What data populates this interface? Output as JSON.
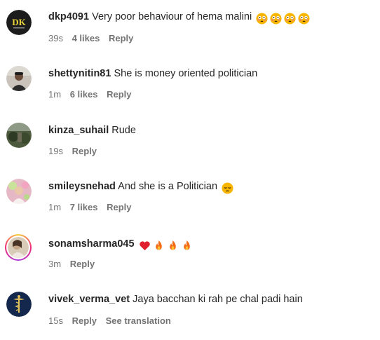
{
  "comments": [
    {
      "username": "dkp4091",
      "text": "Very poor behaviour of hema malini",
      "emoji": [
        "flushed-face",
        "flushed-face",
        "flushed-face",
        "flushed-face"
      ],
      "time": "39s",
      "likes": "4 likes",
      "reply": "Reply",
      "avatar_text": "DK"
    },
    {
      "username": "shettynitin81",
      "text": "She is money oriented politician",
      "emoji": [],
      "time": "1m",
      "likes": "6 likes",
      "reply": "Reply"
    },
    {
      "username": "kinza_suhail",
      "text": "Rude",
      "emoji": [],
      "time": "19s",
      "reply": "Reply"
    },
    {
      "username": "smileysnehad",
      "text": "And she is a Politician",
      "emoji": [
        "pensive-face"
      ],
      "time": "1m",
      "likes": "7 likes",
      "reply": "Reply"
    },
    {
      "username": "sonamsharma045",
      "text": "",
      "emoji": [
        "red-heart",
        "fire",
        "fire",
        "fire"
      ],
      "time": "3m",
      "reply": "Reply"
    },
    {
      "username": "vivek_verma_vet",
      "text": "Jaya bacchan ki rah pe chal padi hain",
      "emoji": [],
      "time": "15s",
      "reply": "Reply",
      "see_translation": "See translation"
    }
  ],
  "colors": {
    "username": "#262626",
    "meta": "#737373",
    "background": "#ffffff"
  }
}
